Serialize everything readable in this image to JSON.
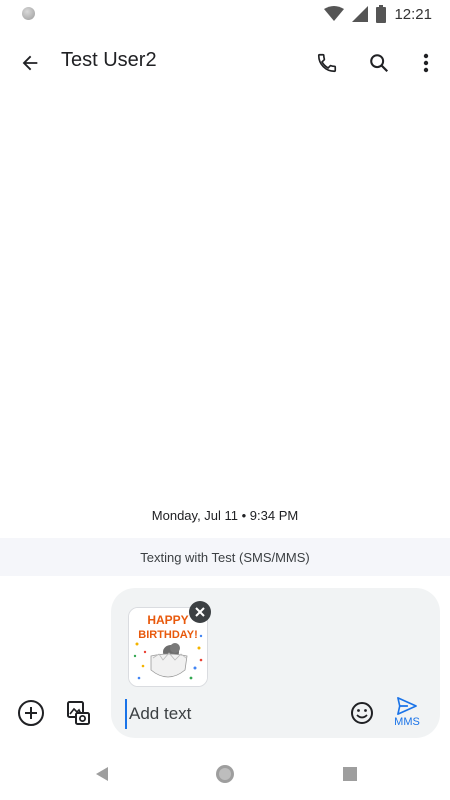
{
  "status_bar": {
    "time": "12:21"
  },
  "app_bar": {
    "title": "Test User2"
  },
  "conversation": {
    "timestamp": "Monday, Jul 11 • 9:34 PM",
    "texting_banner": "Texting with Test (SMS/MMS)"
  },
  "attachment": {
    "sticker_text_line1": "HAPPY",
    "sticker_text_line2": "BIRTHDAY!"
  },
  "composer": {
    "placeholder": "Add text",
    "send_label": "MMS"
  },
  "colors": {
    "accent": "#1a73e8",
    "banner": "#f5f6fa",
    "compose_bg": "#f1f3f4"
  }
}
